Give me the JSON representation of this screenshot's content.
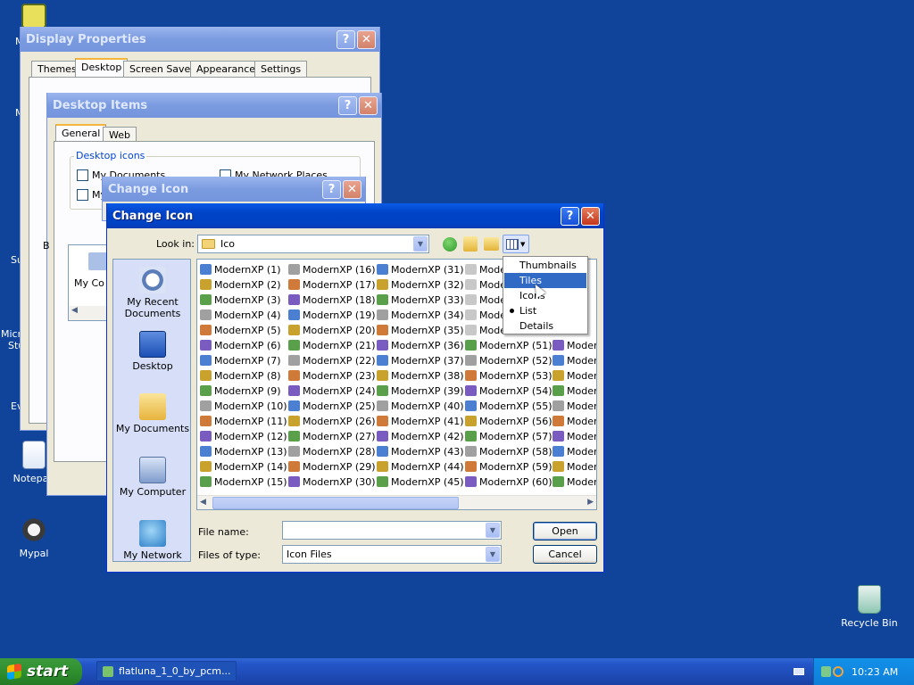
{
  "desktop": {
    "icons": [
      {
        "label": "",
        "name": "desktop-icon-top"
      },
      {
        "label": "Notepad",
        "name": "desktop-icon-notepad"
      },
      {
        "label": "Mypal",
        "name": "desktop-icon-mypal"
      },
      {
        "label": "Recycle Bin",
        "name": "desktop-icon-recycle-bin"
      }
    ],
    "partial_labels": [
      "M",
      "M",
      "Su",
      "Micro",
      "Stu",
      "Ev"
    ]
  },
  "display_properties": {
    "title": "Display Properties",
    "tabs": [
      "Themes",
      "Desktop",
      "Screen Saver",
      "Appearance",
      "Settings"
    ],
    "selected_tab": "Desktop"
  },
  "desktop_items": {
    "title": "Desktop Items",
    "tabs": [
      "General",
      "Web"
    ],
    "group_label": "Desktop icons",
    "checkboxes": [
      "My Documents",
      "My Network Places",
      "My"
    ],
    "partial_item": "My Co",
    "partial_char": "B"
  },
  "change_icon_back": {
    "title": "Change Icon"
  },
  "change_icon": {
    "title": "Change Icon",
    "look_in_label": "Look in:",
    "look_in_value": "Ico",
    "places": [
      "My Recent Documents",
      "Desktop",
      "My Documents",
      "My Computer",
      "My Network"
    ],
    "file_name_label": "File name:",
    "file_name_value": "",
    "files_of_type_label": "Files of type:",
    "files_of_type_value": "Icon Files",
    "open_label": "Open",
    "cancel_label": "Cancel",
    "columns": [
      [
        "ModernXP (1)",
        "ModernXP (2)",
        "ModernXP (3)",
        "ModernXP (4)",
        "ModernXP (5)",
        "ModernXP (6)",
        "ModernXP (7)",
        "ModernXP (8)",
        "ModernXP (9)",
        "ModernXP (10)",
        "ModernXP (11)",
        "ModernXP (12)",
        "ModernXP (13)",
        "ModernXP (14)",
        "ModernXP (15)"
      ],
      [
        "ModernXP (16)",
        "ModernXP (17)",
        "ModernXP (18)",
        "ModernXP (19)",
        "ModernXP (20)",
        "ModernXP (21)",
        "ModernXP (22)",
        "ModernXP (23)",
        "ModernXP (24)",
        "ModernXP (25)",
        "ModernXP (26)",
        "ModernXP (27)",
        "ModernXP (28)",
        "ModernXP (29)",
        "ModernXP (30)"
      ],
      [
        "ModernXP (31)",
        "ModernXP (32)",
        "ModernXP (33)",
        "ModernXP (34)",
        "ModernXP (35)",
        "ModernXP (36)",
        "ModernXP (37)",
        "ModernXP (38)",
        "ModernXP (39)",
        "ModernXP (40)",
        "ModernXP (41)",
        "ModernXP (42)",
        "ModernXP (43)",
        "ModernXP (44)",
        "ModernXP (45)"
      ],
      [
        "Mode",
        "Mode",
        "Mode",
        "Mode",
        "Mode",
        "ModernXP (51)",
        "ModernXP (52)",
        "ModernXP (53)",
        "ModernXP (54)",
        "ModernXP (55)",
        "ModernXP (56)",
        "ModernXP (57)",
        "ModernXP (58)",
        "ModernXP (59)",
        "ModernXP (60)"
      ],
      [
        "",
        "",
        "",
        "",
        "",
        "Modern",
        "Modern",
        "Modern",
        "Modern",
        "Modern",
        "Modern",
        "Modern",
        "Modern",
        "Modern",
        "Modern"
      ]
    ],
    "view_menu": [
      {
        "label": "Thumbnails",
        "highlighted": false,
        "checked": false
      },
      {
        "label": "Tiles",
        "highlighted": true,
        "checked": false
      },
      {
        "label": "Icons",
        "highlighted": false,
        "checked": false
      },
      {
        "label": "List",
        "highlighted": false,
        "checked": true
      },
      {
        "label": "Details",
        "highlighted": false,
        "checked": false
      }
    ]
  },
  "taskbar": {
    "start_label": "start",
    "task_label": "flatluna_1_0_by_pcm...",
    "clock": "10:23 AM"
  },
  "colors": {
    "desktop": "#10449a",
    "titlebar": "#0042c4",
    "highlight": "#316ac5"
  }
}
